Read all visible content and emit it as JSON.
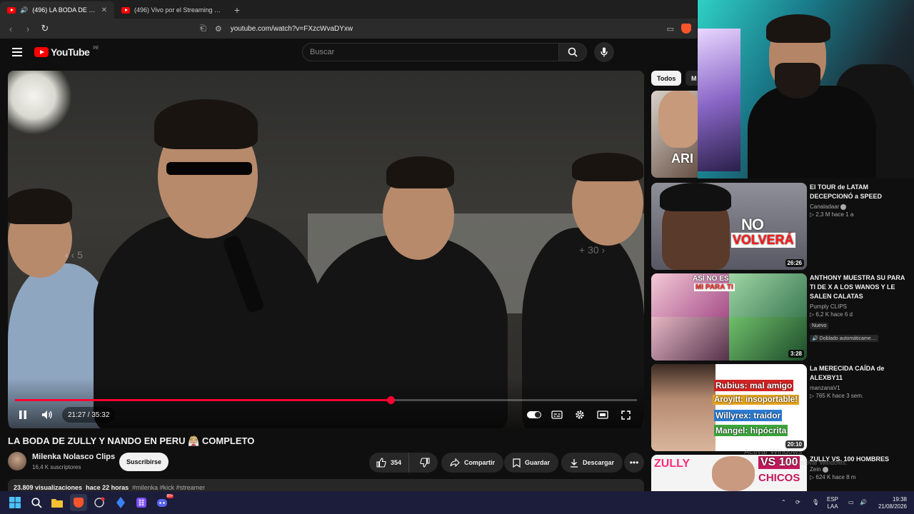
{
  "browser": {
    "tabs": [
      {
        "title": "(496) LA BODA DE ZULLY Y N…",
        "active": true
      },
      {
        "title": "(496) Vivo por el Streaming - YouTub",
        "active": false
      }
    ],
    "url": "youtube.com/watch?v=FXzcWvaDYxw"
  },
  "youtube": {
    "logo_text": "YouTube",
    "region": "PE",
    "search_placeholder": "Buscar"
  },
  "player": {
    "time": "21:27 / 35:32",
    "progress_fraction": 0.6037,
    "seek_back": "5",
    "seek_forward": "+ 30"
  },
  "video": {
    "title": "LA BODA DE ZULLY Y NANDO EN PERU 👰🏼 COMPLETO",
    "channel": "Milenka Nolasco Clips",
    "subscribers": "16,4 K suscriptores",
    "subscribe_label": "Suscribirse",
    "likes": "354",
    "share_label": "Compartir",
    "save_label": "Guardar",
    "download_label": "Descargar",
    "views": "23.809 visualizaciones",
    "age": "hace 22 horas",
    "tags": "#milenka #kick #streamer"
  },
  "chips": [
    "Todos",
    "M"
  ],
  "recommended": [
    {
      "title": "",
      "channel": "",
      "meta": "",
      "duration": ""
    },
    {
      "title": "El TOUR de LATAM DECEPCIONÓ a SPEED",
      "channel": "Canaladaar",
      "meta": "2,3 M  hace 1 a",
      "duration": "26:26",
      "thumb_text": [
        "NO",
        "VOLVERÁ"
      ]
    },
    {
      "title": "ANTHONY MUESTRA SU PARA TI DE X A LOS WANOS Y LE SALEN CALATAS",
      "channel": "Pumply CLIPS",
      "meta": "6,2 K  hace 6 d",
      "badge1": "Nuevo",
      "badge2": "Doblado automáticame…",
      "duration": "3:28",
      "thumb_text": [
        "ASÍ NO ES",
        "MI PARA TI"
      ]
    },
    {
      "title": "La MERECIDA CAÍDA de ALEXBY11",
      "channel": "manzanaV1",
      "meta": "765 K  hace 3 sem.",
      "duration": "20:10",
      "thumb_text": [
        "Rubius: mal amigo",
        "Aroyitt: insoportable!",
        "Willyrex: traidor",
        "Mangel: hipócrita"
      ]
    },
    {
      "title": "ZULLY VS. 100 HOMBRES",
      "channel": "Zein",
      "meta": "624 K  hace 8 m",
      "thumb_text": [
        "ZULLY",
        "VS 100",
        "CHICOS"
      ]
    }
  ],
  "watermark": {
    "line1": "Activar Windows",
    "line2": "para activar Windows."
  },
  "taskbar": {
    "lang1": "ESP",
    "lang2": "LAA",
    "time": "19:38",
    "date": "21/08/2026",
    "chat_badge": "99+"
  }
}
